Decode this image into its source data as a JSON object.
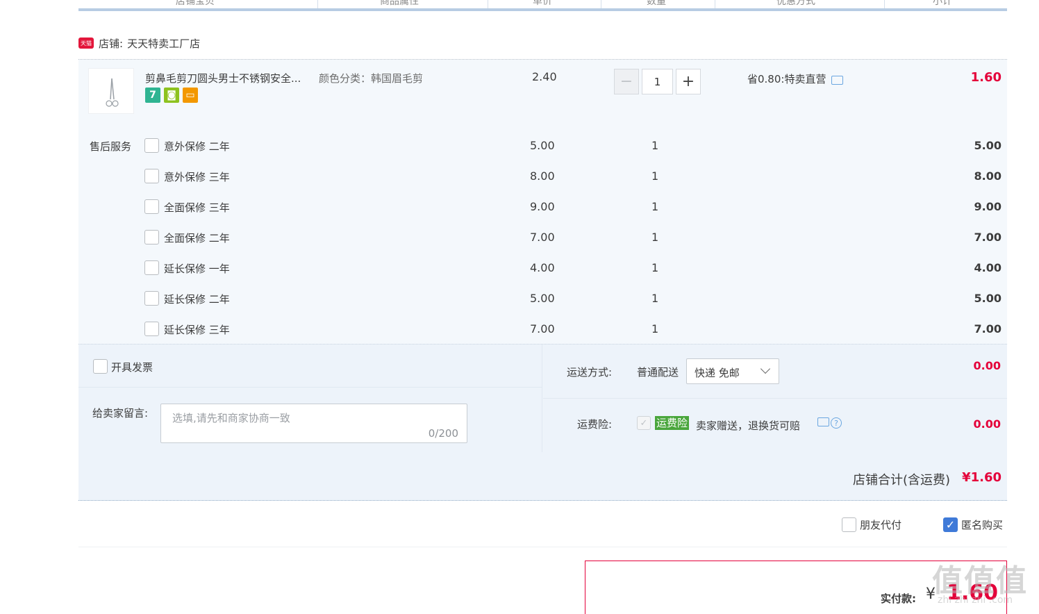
{
  "table_header": {
    "columns": [
      "店铺宝贝",
      "商品属性",
      "单价",
      "数量",
      "优惠方式",
      "小计"
    ]
  },
  "shop": {
    "badge": "天猫",
    "label": "店铺:",
    "name": "天天特卖工厂店"
  },
  "item": {
    "title": "剪鼻毛剪刀圆头男士不锈钢安全...",
    "property": "颜色分类：韩国眉毛剪",
    "unit_price": "2.40",
    "quantity": "1",
    "decrement_symbol": "−",
    "increment_symbol": "+",
    "promotion": "省0.80:特卖直营",
    "subtotal": "1.60",
    "service_icons": [
      {
        "name": "seven-day-return-icon",
        "glyph": "7",
        "color": "#2fb492"
      },
      {
        "name": "quality-guarantee-icon",
        "glyph": "◙",
        "color": "#8dc21f"
      },
      {
        "name": "credit-card-icon",
        "glyph": "▭",
        "color": "#f39800"
      }
    ]
  },
  "after_sales": {
    "label": "售后服务",
    "services": [
      {
        "name": "意外保修 二年",
        "price": "5.00",
        "qty": "1",
        "subtotal": "5.00"
      },
      {
        "name": "意外保修 三年",
        "price": "8.00",
        "qty": "1",
        "subtotal": "8.00"
      },
      {
        "name": "全面保修 三年",
        "price": "9.00",
        "qty": "1",
        "subtotal": "9.00"
      },
      {
        "name": "全面保修 二年",
        "price": "7.00",
        "qty": "1",
        "subtotal": "7.00"
      },
      {
        "name": "延长保修 一年",
        "price": "4.00",
        "qty": "1",
        "subtotal": "4.00"
      },
      {
        "name": "延长保修 二年",
        "price": "5.00",
        "qty": "1",
        "subtotal": "5.00"
      },
      {
        "name": "延长保修 三年",
        "price": "7.00",
        "qty": "1",
        "subtotal": "7.00"
      }
    ]
  },
  "invoice": {
    "label": "开具发票"
  },
  "message": {
    "label": "给卖家留言:",
    "placeholder": "选填,请先和商家协商一致",
    "counter": "0/200"
  },
  "shipping": {
    "label": "运送方式:",
    "mode": "普通配送",
    "selected": "快递 免邮",
    "amount": "0.00"
  },
  "insurance": {
    "label": "运费险:",
    "tag": "运费险",
    "description": "卖家赠送，退换货可赔",
    "amount": "0.00"
  },
  "shop_total": {
    "label": "店铺合计(含运费)",
    "amount": "¥1.60"
  },
  "options": {
    "friend_pay": "朋友代付",
    "anonymous": "匿名购买",
    "anonymous_checked": true
  },
  "payment": {
    "label": "实付款:",
    "currency": "¥",
    "amount": "1.60"
  },
  "watermark": {
    "glyphs": "值值值",
    "url": "zhi zhi zhi .com"
  },
  "colors": {
    "accent_red": "#e4003a",
    "header_rule": "#b7cce3",
    "panel_bg": "#f4f8fc",
    "checkbox_blue": "#3f7ad8"
  }
}
